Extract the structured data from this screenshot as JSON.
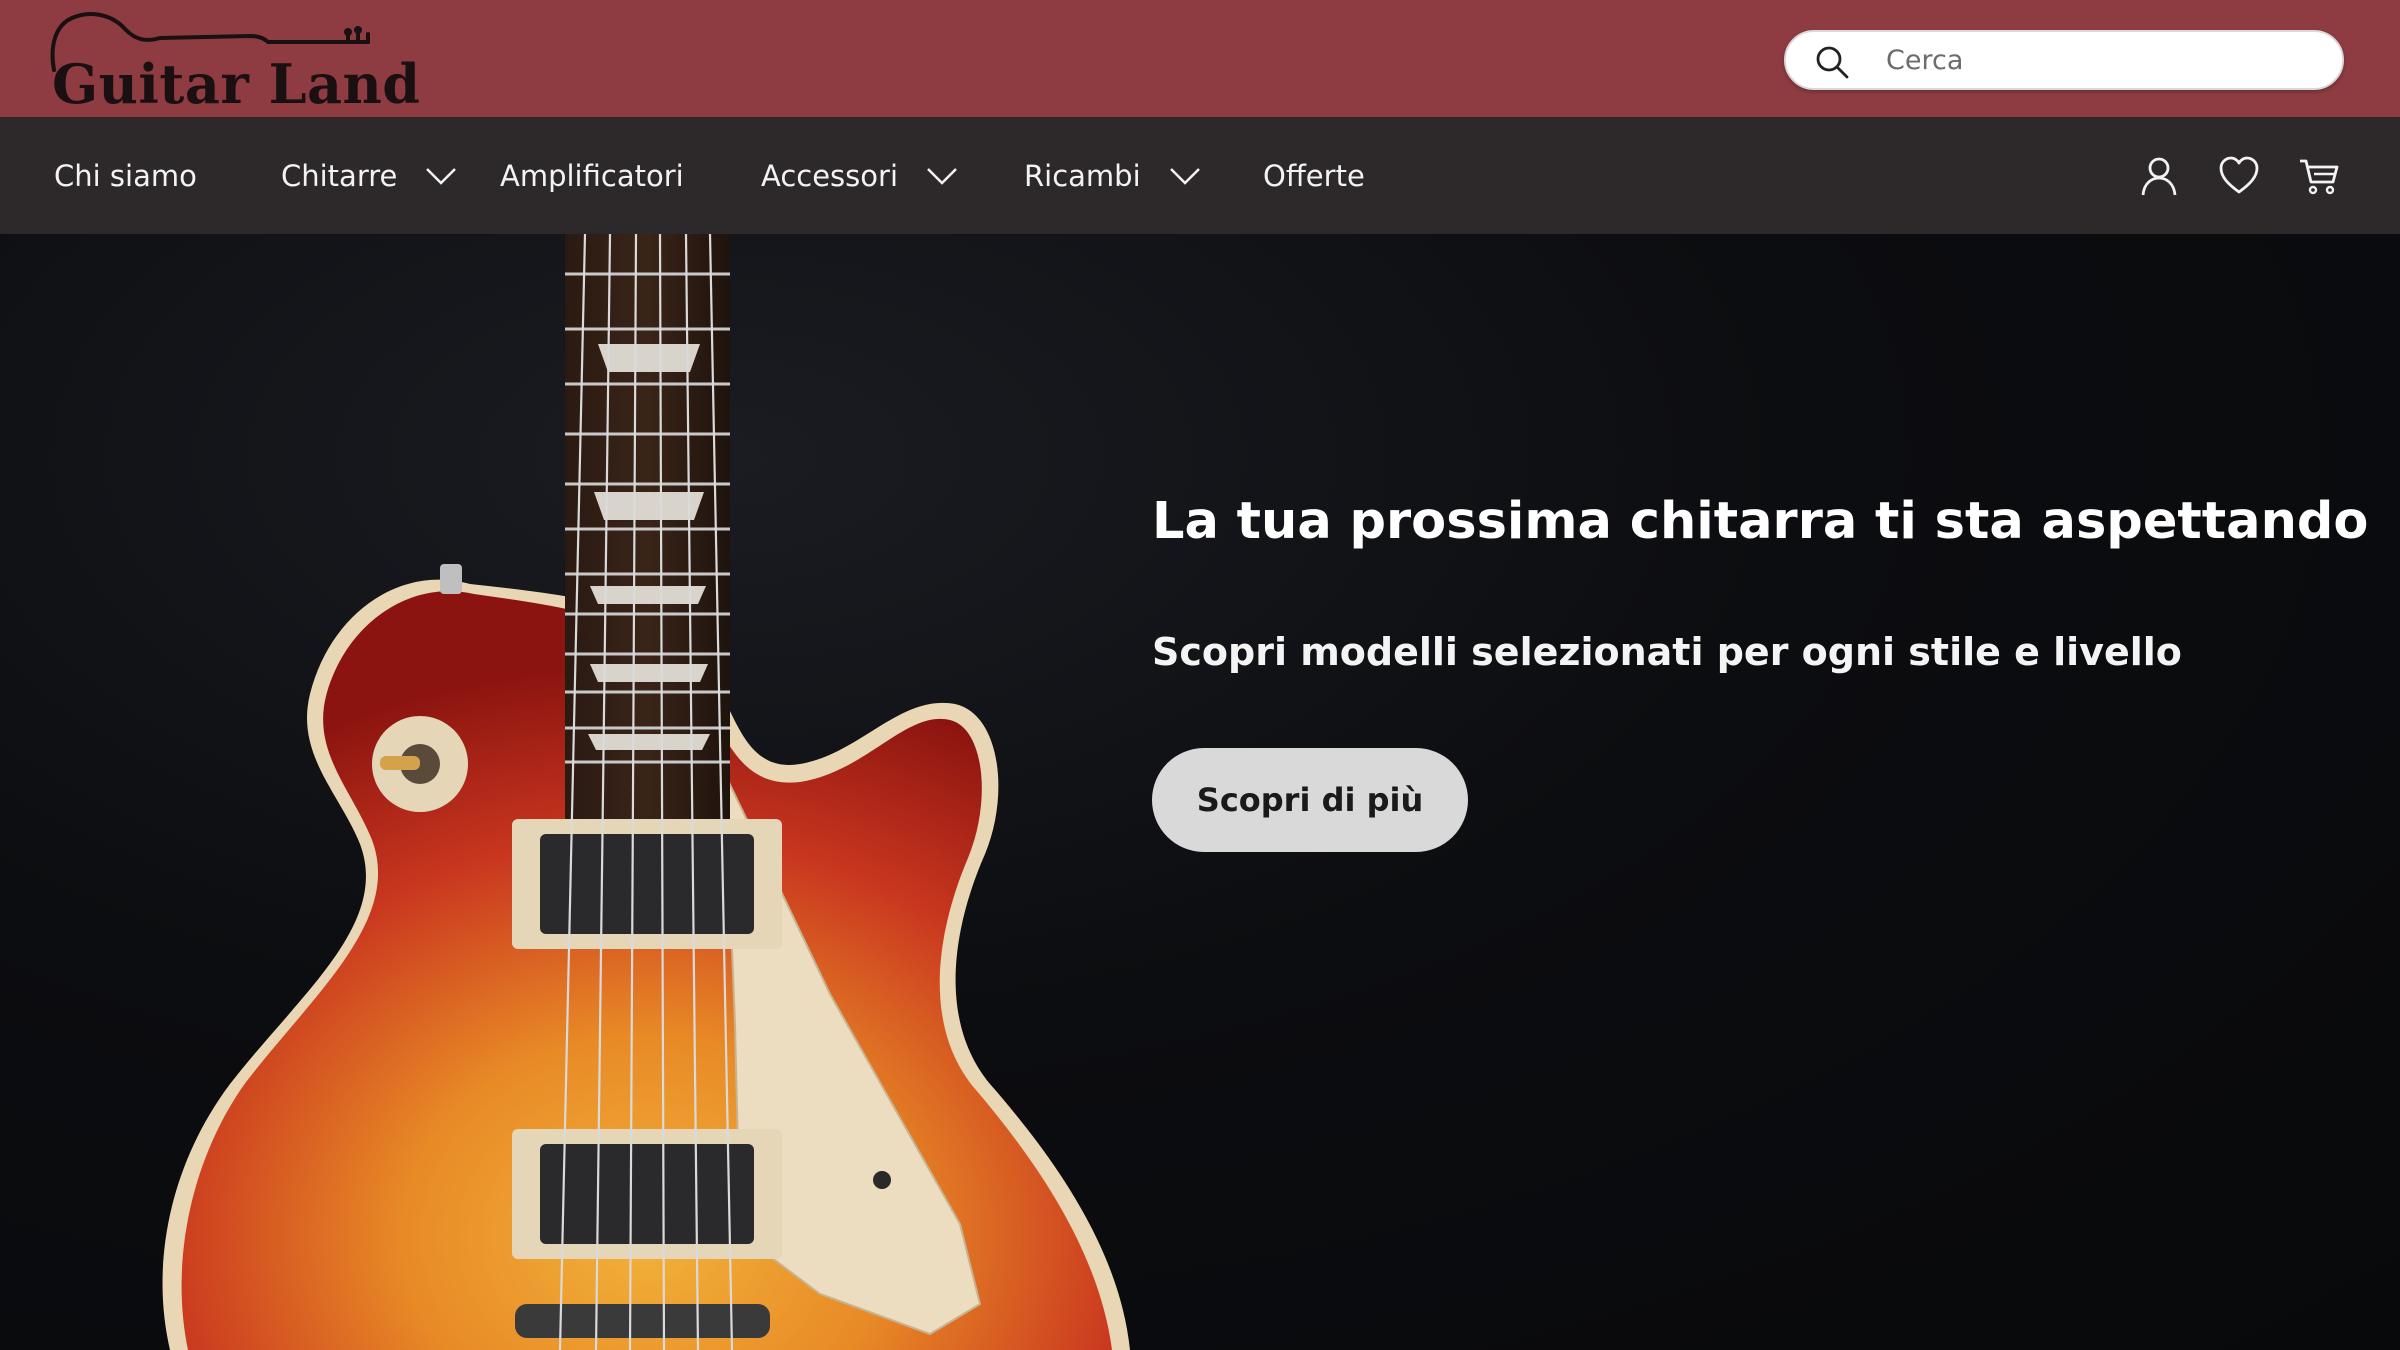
{
  "brand": {
    "name": "Guitar Land",
    "header_color": "#8e3c42",
    "nav_color": "#2d292a"
  },
  "search": {
    "placeholder": "Cerca",
    "value": "",
    "icon": "search-icon"
  },
  "nav": {
    "items": [
      {
        "label": "Chi siamo",
        "has_dropdown": false
      },
      {
        "label": "Chitarre",
        "has_dropdown": true
      },
      {
        "label": "Amplificatori",
        "has_dropdown": false
      },
      {
        "label": "Accessori",
        "has_dropdown": true
      },
      {
        "label": "Ricambi",
        "has_dropdown": true
      },
      {
        "label": "Offerte",
        "has_dropdown": false
      }
    ],
    "icons": [
      "user-icon",
      "heart-icon",
      "cart-icon"
    ]
  },
  "hero": {
    "title": "La tua prossima chitarra ti sta aspettando",
    "subtitle": "Scopri modelli selezionati per ogni stile e livello",
    "cta_label": "Scopri di più",
    "image": "electric-guitar-sunburst"
  }
}
